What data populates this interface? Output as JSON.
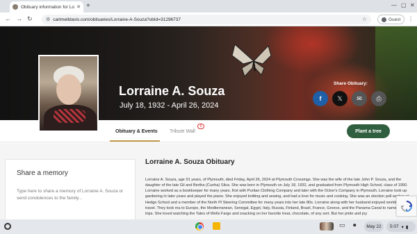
{
  "browser": {
    "tab_title": "Obituary information for Lorrai",
    "url": "cartmelldavis.com/obituaries/Lorraine-A-Souza?obId=31296737",
    "profile": "Guest"
  },
  "hero": {
    "name": "Lorraine A. Souza",
    "dates": "July 18, 1932  -  April 26, 2024",
    "share_label": "Share Obituary:",
    "share_buttons": [
      "facebook-icon",
      "x-icon",
      "mail-icon",
      "print-icon"
    ]
  },
  "tabs": [
    {
      "label": "Obituary & Events"
    },
    {
      "label": "Tribute Wall",
      "badge": "6"
    }
  ],
  "plant_button": "Plant a tree",
  "memory": {
    "title": "Share a memory",
    "placeholder": "Type here to share a memory of Lorraine A. Souza or send condolences to the family..."
  },
  "obituary": {
    "title": "Lorraine A. Souza Obituary",
    "text": "Lorraine A. Souza, age 91 years, of Plymouth, died Friday, April 26, 2024 at Plymouth Crossings. She was the wife of the late John P. Souza, and the daughter of the late Gil and Bertha (Cunha) Silva. She was born in Plymouth on July 18, 1932, and graduated from Plymouth High School, class of 1950. Lorraine worked as a bookkeeper for many years, first with Puritan Clothing Company and later with the Ocker's Company in Plymouth. Lorraine took up gardening in later years and played the piano. She enjoyed knitting and sewing, and had a love for music and cooking. She was an election poll worker at Hedge School and a member of the North Pl Steering Committee for many years into her late 80s. Lorraine along with her husband enjoyed worldwide travel. They took ma to Europe, the Mediterranean, Senegal, Egypt, Italy, Russia, Finland, Brazil, France, Greece, and the Panama Canal to name s their trips. She loved watching the Tales of Wells Fargo and snacking on her favorite treat, chocolate, of any sort. But her pride and joy"
  },
  "shelf": {
    "date": "May 22",
    "time": "5:07"
  }
}
